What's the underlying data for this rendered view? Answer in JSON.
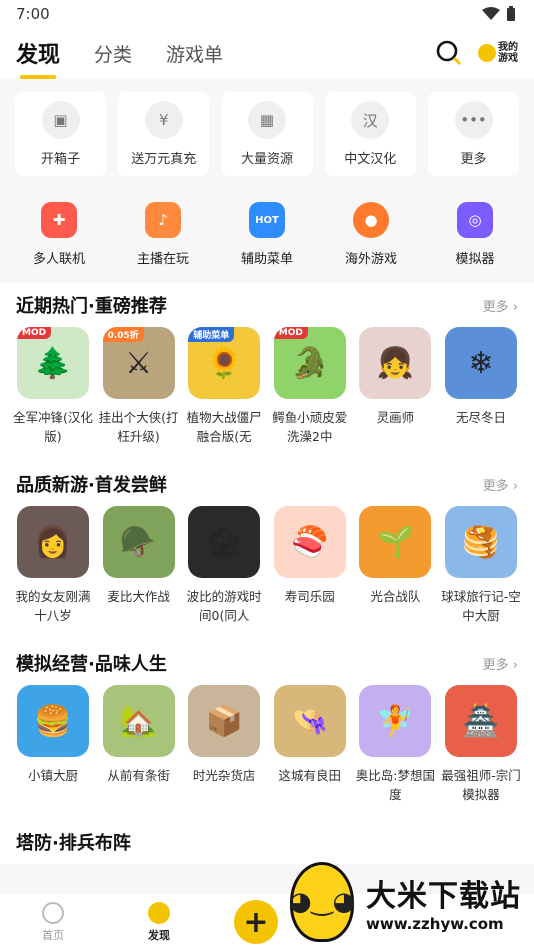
{
  "status": {
    "time": "7:00"
  },
  "header": {
    "tabs": [
      {
        "label": "发现",
        "active": true
      },
      {
        "label": "分类",
        "active": false
      },
      {
        "label": "游戏单",
        "active": false
      }
    ],
    "mygame_label_1": "我的",
    "mygame_label_2": "游戏"
  },
  "quick": [
    {
      "label": "开箱子",
      "icon": "▣"
    },
    {
      "label": "送万元真充",
      "icon": "¥"
    },
    {
      "label": "大量资源",
      "icon": "▦"
    },
    {
      "label": "中文汉化",
      "icon": "汉"
    },
    {
      "label": "更多",
      "icon": "•••"
    }
  ],
  "categories": [
    {
      "label": "多人联机",
      "icon": "✚",
      "color": "#ff5b4c"
    },
    {
      "label": "主播在玩",
      "icon": "♪",
      "color": "#ff8a3d"
    },
    {
      "label": "辅助菜单",
      "icon": "HOT",
      "color": "#2f8cff"
    },
    {
      "label": "海外游戏",
      "icon": "●",
      "color": "#ff7a2b"
    },
    {
      "label": "模拟器",
      "icon": "◎",
      "color": "#7a5cff"
    }
  ],
  "sections": [
    {
      "title": "近期热门·重磅推荐",
      "more": "更多",
      "games": [
        {
          "name": "全军冲锋(汉化版)",
          "tag": "MOD",
          "bg": "#cfe8c6",
          "emoji": "🌲"
        },
        {
          "name": "挂出个大侠(打枉升级)",
          "tag": "0.05折",
          "bg": "#b9a47e",
          "emoji": "⚔"
        },
        {
          "name": "植物大战僵尸融合版(无",
          "tag": "辅助菜单",
          "bg": "#f3c83a",
          "emoji": "🌻"
        },
        {
          "name": "鳄鱼小顽皮爱洗澡2中",
          "tag": "MOD",
          "bg": "#8fd36a",
          "emoji": "🐊"
        },
        {
          "name": "灵画师",
          "tag": "",
          "bg": "#e8d2d0",
          "emoji": "👧"
        },
        {
          "name": "无尽冬日",
          "tag": "",
          "bg": "#5b8fd8",
          "emoji": "❄"
        }
      ]
    },
    {
      "title": "品质新游·首发尝鲜",
      "more": "更多",
      "games": [
        {
          "name": "我的女友刚满十八岁",
          "tag": "",
          "bg": "#6b5a55",
          "emoji": "👩"
        },
        {
          "name": "麦比大作战",
          "tag": "",
          "bg": "#7fa35a",
          "emoji": "🪖"
        },
        {
          "name": "波比的游戏时间0(同人",
          "tag": "",
          "bg": "#2a2a2a",
          "emoji": "🏚"
        },
        {
          "name": "寿司乐园",
          "tag": "",
          "bg": "#ffd7c9",
          "emoji": "🍣"
        },
        {
          "name": "光合战队",
          "tag": "",
          "bg": "#f39b2e",
          "emoji": "🌱"
        },
        {
          "name": "球球旅行记-空中大厨",
          "tag": "",
          "bg": "#8ab8e8",
          "emoji": "🥞"
        }
      ]
    },
    {
      "title": "模拟经营·品味人生",
      "more": "更多",
      "games": [
        {
          "name": "小镇大厨",
          "tag": "",
          "bg": "#3fa3e8",
          "emoji": "🍔"
        },
        {
          "name": "从前有条街",
          "tag": "",
          "bg": "#a7c47a",
          "emoji": "🏡"
        },
        {
          "name": "时光杂货店",
          "tag": "",
          "bg": "#c9b59a",
          "emoji": "📦"
        },
        {
          "name": "这城有良田",
          "tag": "",
          "bg": "#d8b87a",
          "emoji": "👒"
        },
        {
          "name": "奥比岛:梦想国度",
          "tag": "",
          "bg": "#c4b0f0",
          "emoji": "🧚"
        },
        {
          "name": "最强祖师-宗门模拟器",
          "tag": "",
          "bg": "#e8604a",
          "emoji": "🏯"
        }
      ]
    },
    {
      "title": "塔防·排兵布阵",
      "more": "",
      "games": []
    }
  ],
  "bottom_nav": [
    {
      "label": "首页",
      "active": false
    },
    {
      "label": "发现",
      "active": true
    }
  ],
  "plus_icon": "+",
  "watermark": {
    "big": "大米下载站",
    "url": "www.zzhyw.com"
  }
}
